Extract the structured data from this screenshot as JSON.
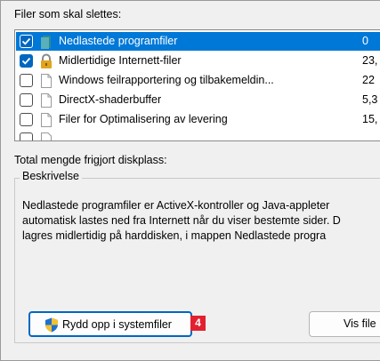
{
  "files_section": {
    "label": "Filer som skal slettes:"
  },
  "files": [
    {
      "name": "Nedlastede programfiler",
      "size": "0",
      "checked": true,
      "selected": true,
      "icon": "folder-icon"
    },
    {
      "name": "Midlertidige Internett-filer",
      "size": "23,",
      "checked": true,
      "selected": false,
      "icon": "lock-icon"
    },
    {
      "name": "Windows feilrapportering og tilbakemeldin...",
      "size": "22",
      "checked": false,
      "selected": false,
      "icon": "document-icon"
    },
    {
      "name": "DirectX-shaderbuffer",
      "size": "5,3",
      "checked": false,
      "selected": false,
      "icon": "document-icon"
    },
    {
      "name": "Filer for Optimalisering av levering",
      "size": "15,",
      "checked": false,
      "selected": false,
      "icon": "document-icon"
    }
  ],
  "total": {
    "label": "Total mengde frigjort diskplass:"
  },
  "description": {
    "legend": "Beskrivelse",
    "lines": [
      "Nedlastede programfiler er ActiveX-kontroller og Java-appleter",
      "automatisk lastes ned fra Internett når du viser bestemte sider. D",
      "lagres midlertidig på harddisken, i mappen Nedlastede progra"
    ]
  },
  "buttons": {
    "cleanup_label": "Rydd opp i systemfiler",
    "cleanup_badge": "4",
    "view_label": "Vis file"
  },
  "colors": {
    "selection": "#0078d7",
    "checkbox": "#0067c0",
    "badge": "#e3202f"
  }
}
